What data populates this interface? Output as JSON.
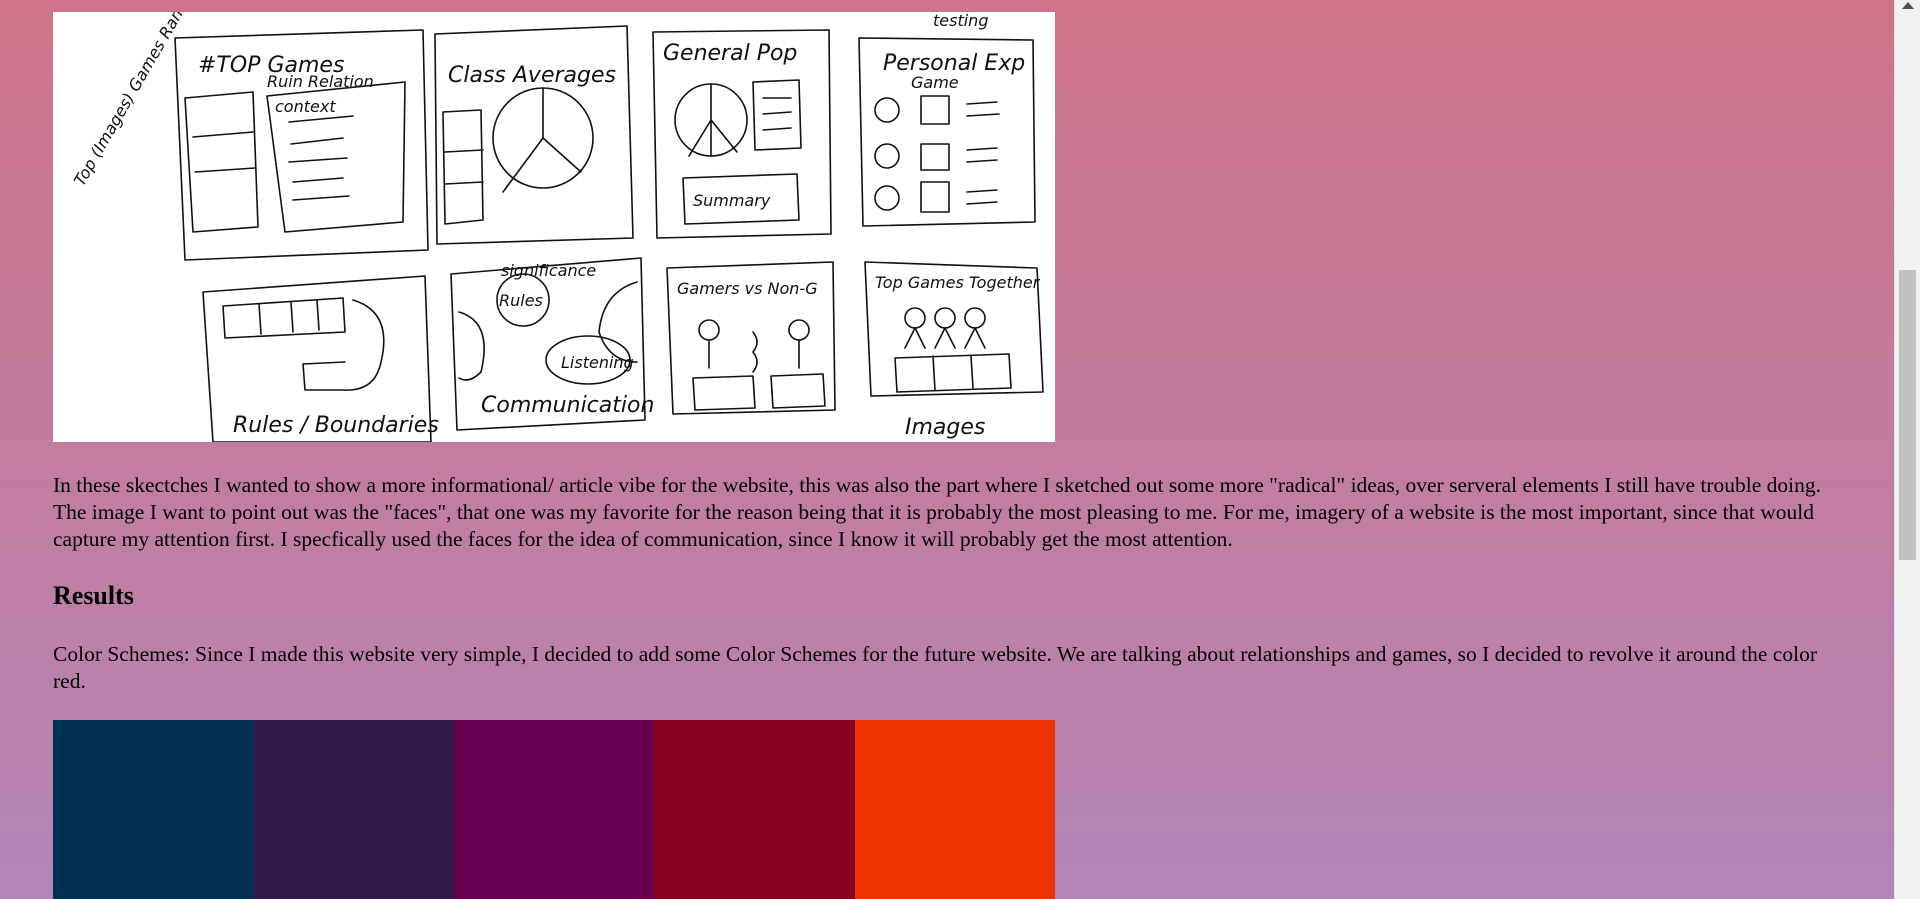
{
  "sketch": {
    "labels": {
      "top_games": "#TOP Games",
      "ruin_relation": "Ruin Relation",
      "context": "context",
      "top_images_games_rank": "Top (Images) Games Rank",
      "class_averages": "Class Averages",
      "general_pop": "General Pop",
      "summary": "Summary",
      "personal_exp": "Personal Exp",
      "game": "Game",
      "rules_boundaries": "Rules / Boundaries",
      "significance": "significance",
      "rules": "Rules",
      "listening": "Listening",
      "communication": "Communication",
      "gamers_vs_non_g": "Gamers vs Non-G",
      "top_games_together": "Top Games Together",
      "images": "Images",
      "testing": "testing"
    }
  },
  "article": {
    "paragraph1": "In these skectches I wanted to show a more informational/ article vibe for the website, this was also the part where I sketched out some more \"radical\" ideas, over serveral elements I still have trouble doing. The image I want to point out was the \"faces\", that one was my favorite for the reason being that it is probably the most pleasing to me. For me, imagery of a website is the most important, since that would capture my attention first. I specfically used the faces for the idea of communication, since I know it will probably get the most attention.",
    "results_heading": "Results",
    "paragraph2": "Color Schemes: Since I made this website very simple, I decided to add some Color Schemes for the future website. We are talking about relationships and games, so I decided to revolve it around the color red."
  },
  "palette": {
    "colors": [
      "#003153",
      "#331a4d",
      "#680052",
      "#880022",
      "#ec3200"
    ]
  }
}
